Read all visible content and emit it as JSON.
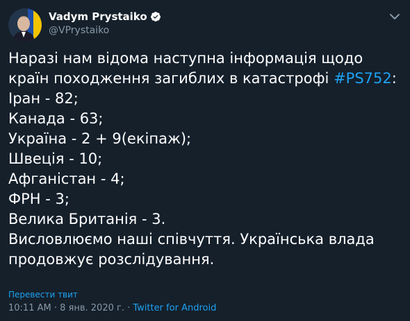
{
  "author": {
    "display_name": "Vadym Prystaiko",
    "handle": "@VPrystaiko",
    "verified": true
  },
  "tweet": {
    "intro_part1": "Наразі нам відома наступна інформація щодо країн походження загиблих в катастрофі ",
    "hashtag": "#PS752",
    "intro_part2": ":",
    "lines": [
      "Іран - 82;",
      "Канада - 63;",
      "Україна - 2 + 9(екіпаж);",
      "Швеція - 10;",
      "Афганістан - 4;",
      "ФРН - 3;",
      "Велика Британія - 3.",
      "Висловлюємо наші співчуття. Українська влада продовжує розслідування."
    ]
  },
  "footer": {
    "translate_label": "Перевести твит",
    "time": "10:11 AM",
    "separator": " · ",
    "date": "8 янв. 2020 г.",
    "source": "Twitter for Android"
  },
  "icons": {
    "verified": "verified-badge-icon",
    "menu": "chevron-down-icon"
  },
  "colors": {
    "background": "#15202b",
    "accent": "#1da1f2",
    "secondary_text": "#8899a6"
  }
}
